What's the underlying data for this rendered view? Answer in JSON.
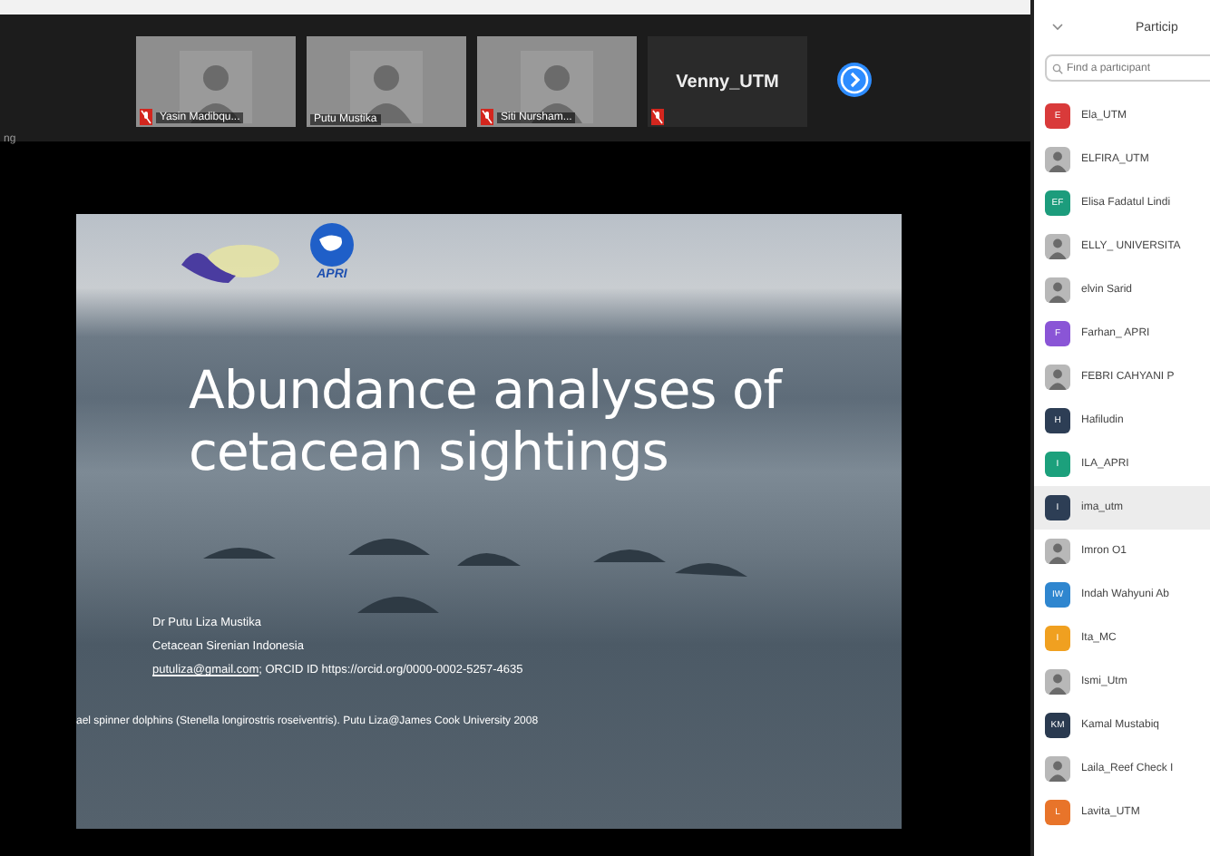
{
  "video_tiles": [
    {
      "name": "Yasin Madibqu...",
      "kind": "photo",
      "muted": true
    },
    {
      "name": "Putu Mustika",
      "kind": "photo",
      "muted": false
    },
    {
      "name": "Siti Nursham...",
      "kind": "photo",
      "muted": true
    },
    {
      "name": "Venny_UTM",
      "kind": "name",
      "muted": true
    }
  ],
  "side_label": "ng",
  "slide": {
    "logo_text": "APRI",
    "title": "Abundance analyses of cetacean sightings",
    "author": "Dr Putu Liza Mustika",
    "affiliation": "Cetacean Sirenian Indonesia",
    "email": "putuliza@gmail.com",
    "orcid": "; ORCID ID https://orcid.org/0000-0002-5257-4635",
    "caption": "ael spinner dolphins (Stenella longirostris roseiventris). Putu Liza@James Cook University 2008"
  },
  "participants": {
    "title": "Particip",
    "search_placeholder": "Find a participant",
    "items": [
      {
        "name": "Ela_UTM",
        "kind": "initials",
        "initials": "E",
        "color": "#d93a3a",
        "selected": false
      },
      {
        "name": "ELFIRA_UTM",
        "kind": "photo",
        "selected": false
      },
      {
        "name": "Elisa Fadatul Lindi",
        "kind": "initials",
        "initials": "EF",
        "color": "#1c9c7c",
        "selected": false
      },
      {
        "name": "ELLY_ UNIVERSITA",
        "kind": "photo",
        "selected": false
      },
      {
        "name": "elvin Sarid",
        "kind": "photo",
        "selected": false
      },
      {
        "name": "Farhan_ APRI",
        "kind": "initials",
        "initials": "F",
        "color": "#8a55d6",
        "selected": false
      },
      {
        "name": "FEBRI CAHYANI P",
        "kind": "photo",
        "selected": false
      },
      {
        "name": "Hafiludin",
        "kind": "initials",
        "initials": "H",
        "color": "#2d3e55",
        "selected": false
      },
      {
        "name": "ILA_APRI",
        "kind": "initials",
        "initials": "I",
        "color": "#1ca07c",
        "selected": false
      },
      {
        "name": "ima_utm",
        "kind": "initials",
        "initials": "I",
        "color": "#2d3e55",
        "selected": true
      },
      {
        "name": "Imron O1",
        "kind": "photo",
        "selected": false
      },
      {
        "name": "Indah Wahyuni Ab",
        "kind": "initials",
        "initials": "IW",
        "color": "#2f86cf",
        "selected": false
      },
      {
        "name": "Ita_MC",
        "kind": "initials",
        "initials": "I",
        "color": "#f0a020",
        "selected": false
      },
      {
        "name": "Ismi_Utm",
        "kind": "photo",
        "selected": false
      },
      {
        "name": "Kamal Mustabiq",
        "kind": "initials",
        "initials": "KM",
        "color": "#2a3a50",
        "selected": false
      },
      {
        "name": "Laila_Reef Check I",
        "kind": "photo",
        "selected": false
      },
      {
        "name": "Lavita_UTM",
        "kind": "initials",
        "initials": "L",
        "color": "#e8742a",
        "selected": false
      }
    ]
  }
}
